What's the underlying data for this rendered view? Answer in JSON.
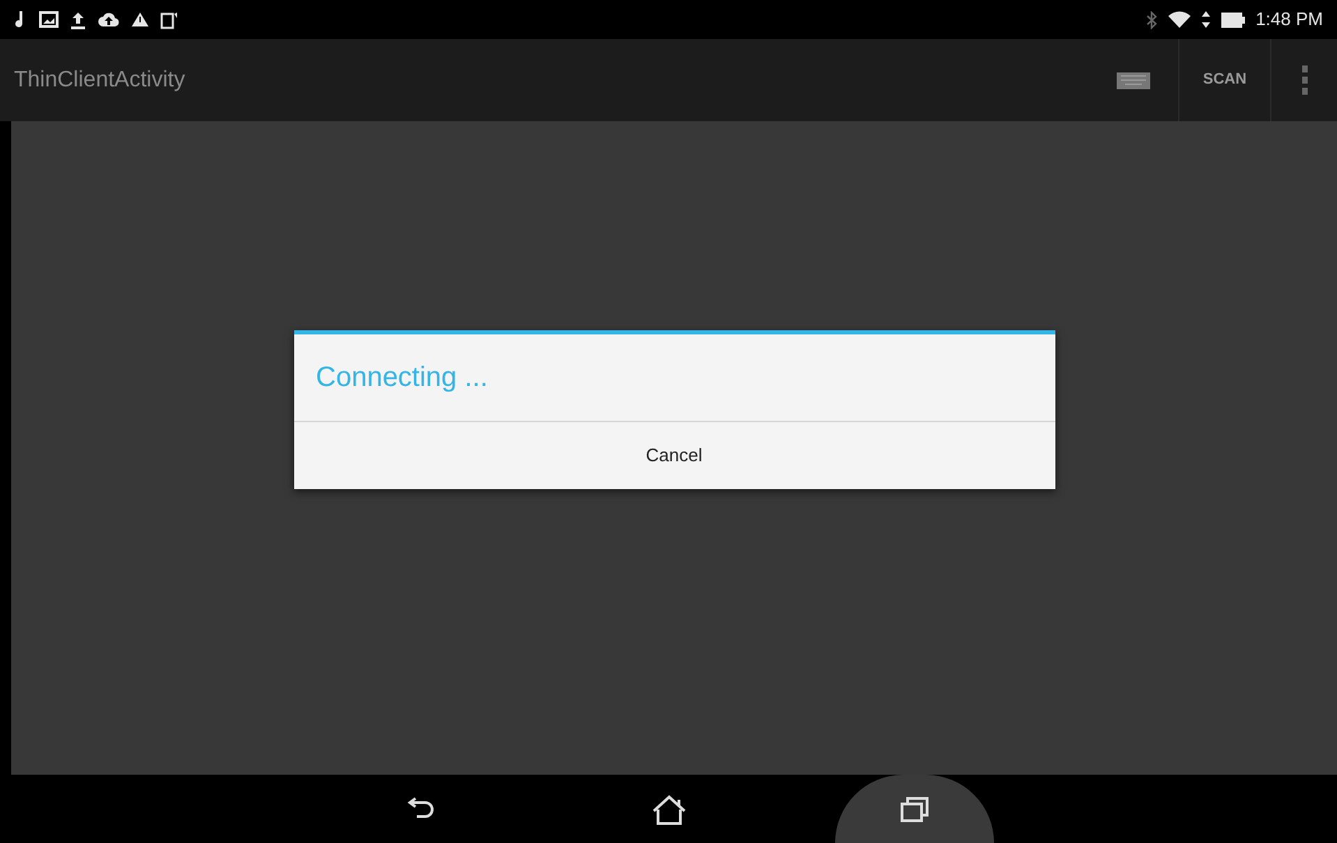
{
  "status_bar": {
    "time": "1:48 PM"
  },
  "action_bar": {
    "title": "ThinClientActivity",
    "actions": [
      {
        "kind": "keyboard"
      },
      {
        "kind": "text",
        "label": "SCAN"
      },
      {
        "kind": "overflow"
      }
    ]
  },
  "dialog": {
    "title": "Connecting ...",
    "buttons": [
      "Cancel"
    ]
  },
  "nav_bar": [
    {
      "kind": "back",
      "pressed": false
    },
    {
      "kind": "home",
      "pressed": false
    },
    {
      "kind": "recents",
      "pressed": true
    }
  ]
}
